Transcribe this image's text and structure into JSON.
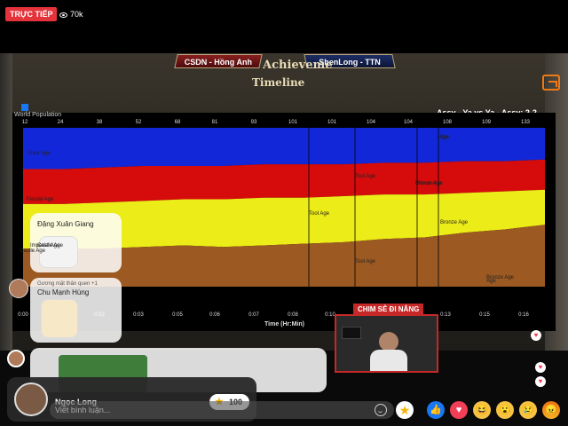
{
  "live": {
    "label": "TRỰC TIẾP",
    "viewers": "70k"
  },
  "scoreboard": {
    "left_team": "CSDN - Hồng Anh",
    "right_team": "ShenLong - TTN",
    "series": "Assy - Ya vs Ya - Assy: 2-2"
  },
  "game": {
    "achievement_header": "Achieveme",
    "tab": "Timeline",
    "world_population": "World Population"
  },
  "chart_data": {
    "type": "area",
    "title": "",
    "xlabel": "Time (Hr:Min)",
    "ylabel": "",
    "x_ticks": [
      "0:00",
      "0:02",
      "0:03",
      "0:05",
      "0:06",
      "0:07",
      "0:08",
      "0:10",
      "0:12",
      "0:13",
      "0:15",
      "0:16"
    ],
    "population_ticks": [
      "12",
      "24",
      "38",
      "52",
      "68",
      "81",
      "93",
      "101",
      "101",
      "104",
      "104",
      "108",
      "109",
      "133"
    ],
    "series": [
      {
        "color": "#1228d8",
        "values": [
          0.26,
          0.26,
          0.25,
          0.24,
          0.24,
          0.24,
          0.23,
          0.23,
          0.23,
          0.22,
          0.22,
          0.21,
          0.21,
          0.2
        ]
      },
      {
        "color": "#d60c0c",
        "values": [
          0.22,
          0.22,
          0.22,
          0.22,
          0.21,
          0.21,
          0.21,
          0.21,
          0.2,
          0.2,
          0.2,
          0.2,
          0.19,
          0.19
        ]
      },
      {
        "color": "#ecec18",
        "values": [
          0.28,
          0.28,
          0.29,
          0.29,
          0.29,
          0.3,
          0.3,
          0.29,
          0.29,
          0.28,
          0.27,
          0.25,
          0.24,
          0.22
        ]
      },
      {
        "color": "#9c5a22",
        "values": [
          0.24,
          0.24,
          0.24,
          0.25,
          0.26,
          0.25,
          0.26,
          0.27,
          0.28,
          0.3,
          0.31,
          0.34,
          0.36,
          0.39
        ]
      }
    ],
    "annotations": [
      "Dark Age",
      "Feudal Age",
      "Castle Age",
      "Imperial Age",
      "Tool Age",
      "Bronze Age",
      "Bronze Age",
      "Bronze Age",
      "Tool Age",
      "Tool Age",
      "Age",
      "Castle Age",
      "Stone Age",
      "Age",
      "Age"
    ]
  },
  "cam": {
    "title": "CHIM SẺ ĐI NẮNG"
  },
  "comments": [
    {
      "name": "Đặng Xuân Giang"
    },
    {
      "sub": "Gương mặt thân quen +1",
      "name": "Chu Mạnh Hùng"
    }
  ],
  "composer": {
    "name": "Ngọc Long",
    "stars": "100",
    "placeholder": "Viết bình luận..."
  },
  "icons": [
    "eye-icon",
    "facebook-icon",
    "emoji-icon",
    "star-icon",
    "like-icon",
    "love-icon",
    "haha-icon",
    "wow-icon",
    "sad-icon",
    "angry-icon",
    "heart-icon"
  ]
}
